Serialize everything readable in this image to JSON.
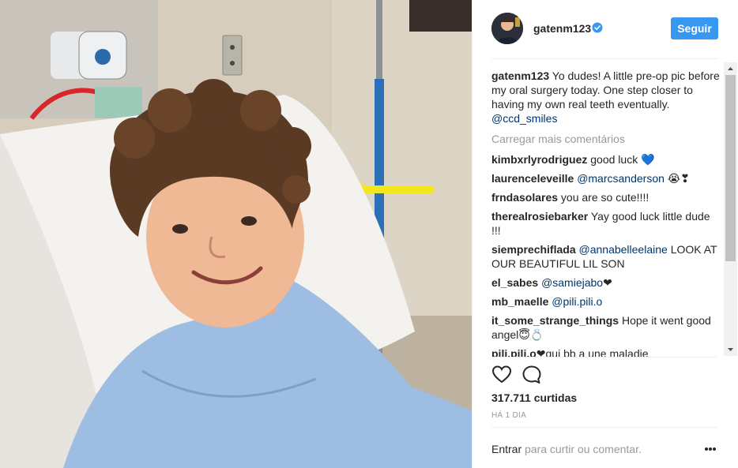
{
  "post": {
    "image_alt": "Boy with curly hair smiling in hospital bed wearing a blue gown"
  },
  "header": {
    "username": "gatenm123",
    "follow_label": "Seguir"
  },
  "caption": {
    "username": "gatenm123",
    "text": " Yo dudes! A little pre-op pic before my oral surgery today. One step closer to having my own real teeth eventually. ",
    "mention": "@ccd_smiles"
  },
  "load_more_label": "Carregar mais comentários",
  "comments": [
    {
      "user": "kimbxrlyrodriguez",
      "mention": "",
      "text": " good luck 💙"
    },
    {
      "user": "laurenceleveille",
      "mention": "@marcsanderson",
      "text": " 😭❣"
    },
    {
      "user": "frndasolares",
      "mention": "",
      "text": " you are so cute!!!!"
    },
    {
      "user": "therealrosiebarker",
      "mention": "",
      "text": " Yay good luck little dude !!!"
    },
    {
      "user": "siemprechiflada",
      "mention": "@annabelleelaine",
      "text": " LOOK AT OUR BEAUTIFUL LIL SON"
    },
    {
      "user": "el_sabes",
      "mention": "@samiejabo",
      "text": "❤"
    },
    {
      "user": "mb_maelle",
      "mention": "@pili.pili.o",
      "text": ""
    },
    {
      "user": "it_some_strange_things",
      "mention": "",
      "text": " Hope it went good angel😇💍"
    },
    {
      "user": "pili.pili.o",
      "mention": "",
      "text": "❤qui bb a une maladie"
    }
  ],
  "likes_text": "317.711 curtidas",
  "time_text": "HÁ 1 DIA",
  "login": {
    "link": "Entrar",
    "text": " para curtir ou comentar."
  },
  "icons": {
    "like": "heart-outline-icon",
    "comment": "comment-bubble-icon",
    "verified": "verified-badge-icon",
    "more": "more-options-icon"
  },
  "colors": {
    "accent": "#3897f0",
    "mention": "#003569",
    "muted": "#999999"
  }
}
